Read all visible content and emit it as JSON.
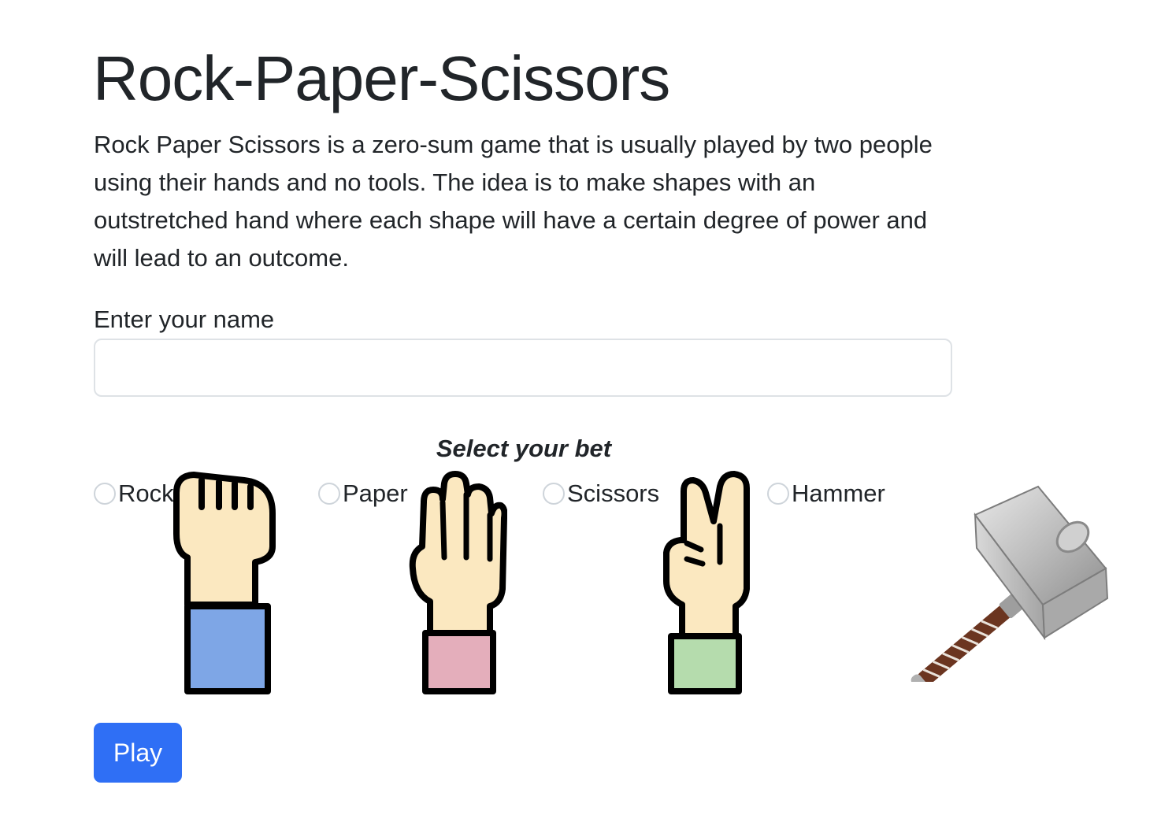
{
  "page": {
    "title": "Rock-Paper-Scissors",
    "intro": "Rock Paper Scissors is a zero-sum game that is usually played by two people using their hands and no tools. The idea is to make shapes with an outstretched hand where each shape will have a certain degree of power and will lead to an outcome."
  },
  "name_field": {
    "label": "Enter your name",
    "value": "",
    "placeholder": ""
  },
  "bet": {
    "heading": "Select your bet",
    "options": [
      {
        "label": "Rock",
        "icon": "fist-icon",
        "sleeve_color": "#7ea6e6",
        "checked": false
      },
      {
        "label": "Paper",
        "icon": "open-hand-icon",
        "sleeve_color": "#e4aebb",
        "checked": false
      },
      {
        "label": "Scissors",
        "icon": "victory-hand-icon",
        "sleeve_color": "#b5dcad",
        "checked": false
      },
      {
        "label": "Hammer",
        "icon": "hammer-icon",
        "checked": false
      }
    ]
  },
  "colors": {
    "skin": "#fbe8c0",
    "outline": "#000000",
    "primary_button": "#2f6ff5"
  },
  "play_button": {
    "label": "Play"
  }
}
